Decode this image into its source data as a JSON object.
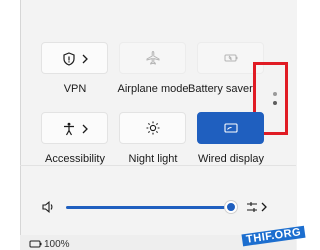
{
  "quick_settings": {
    "tiles": [
      {
        "label": "VPN",
        "icon": "shield-icon",
        "state": "off",
        "has_chevron": true
      },
      {
        "label": "Airplane mode",
        "icon": "airplane-icon",
        "state": "disabled",
        "has_chevron": false
      },
      {
        "label": "Battery saver",
        "icon": "battery-saver-icon",
        "state": "disabled",
        "has_chevron": false
      },
      {
        "label": "Accessibility",
        "icon": "accessibility-icon",
        "state": "off",
        "has_chevron": true
      },
      {
        "label": "Night light",
        "icon": "brightness-icon",
        "state": "off",
        "has_chevron": false
      },
      {
        "label": "Wired display",
        "icon": "display-icon",
        "state": "on",
        "has_chevron": false
      }
    ],
    "page_indicator": {
      "pages": 2,
      "current": 2
    }
  },
  "volume": {
    "icon": "speaker-icon",
    "level_percent": 100,
    "output_icon": "audio-output-icon"
  },
  "footer": {
    "battery_text": "100%"
  },
  "watermark": "THIF.ORG",
  "colors": {
    "accent": "#1f5fbf",
    "highlight_box": "#e01b24"
  }
}
